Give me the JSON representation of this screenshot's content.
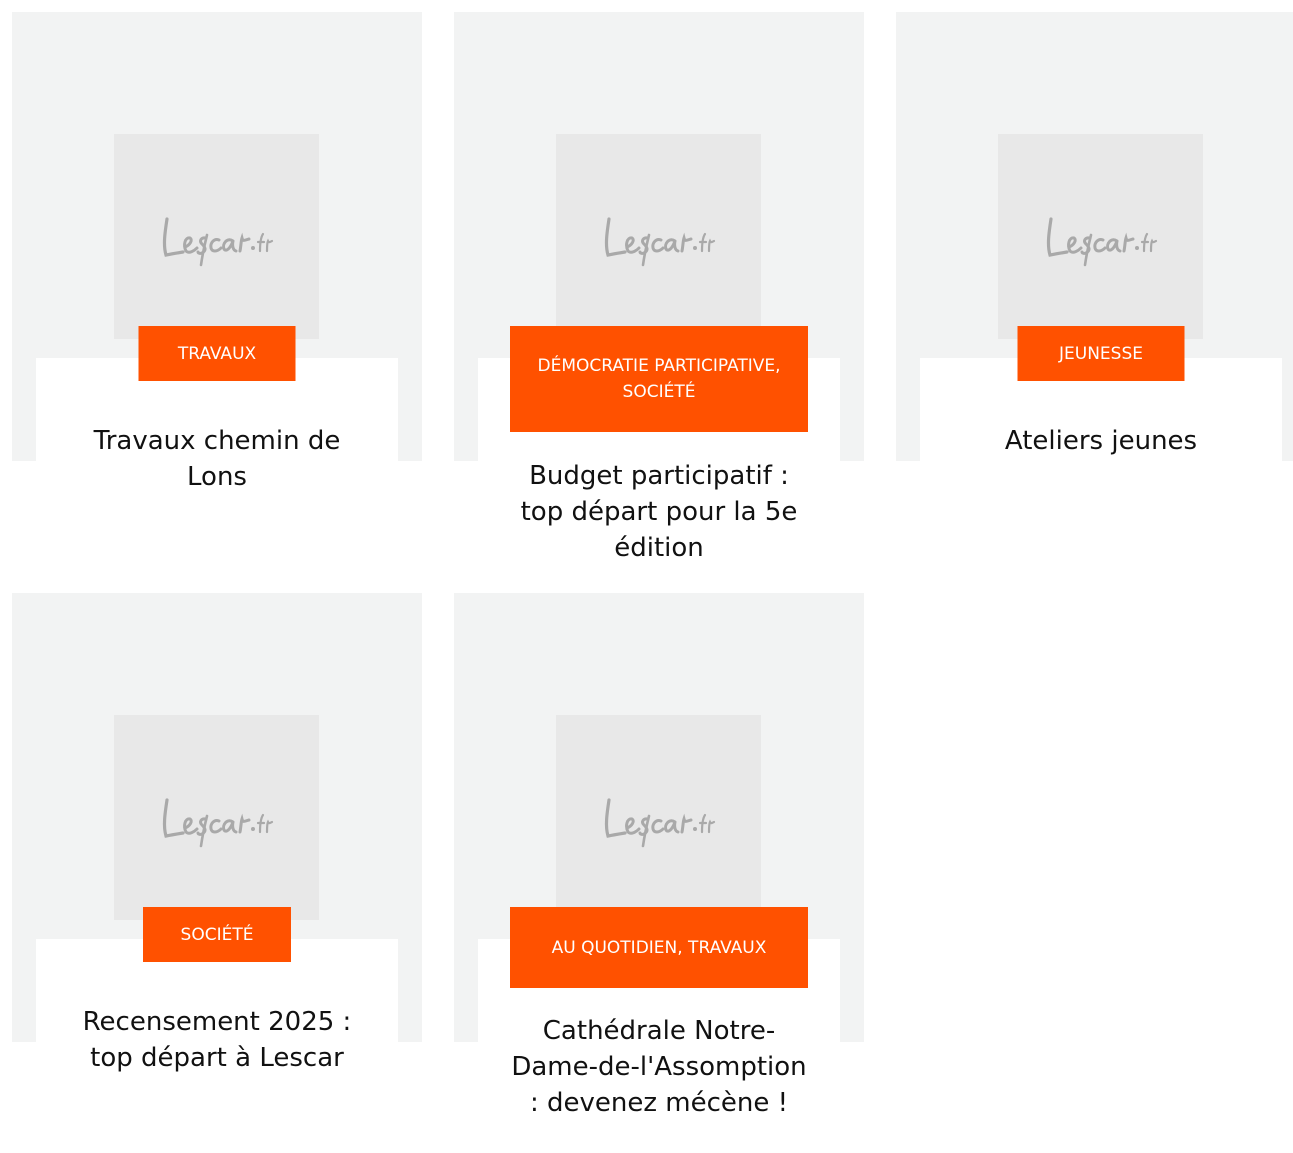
{
  "logo_text": "Lescar.fr",
  "colors": {
    "accent": "#ff5100",
    "card_bg": "#f2f3f3",
    "thumb_bg": "#e8e8e8",
    "logo": "#a9a9a9"
  },
  "articles": [
    {
      "category": "TRAVAUX",
      "title": "Travaux chemin de Lons"
    },
    {
      "category": "DÉMOCRATIE PARTICIPATIVE, SOCIÉTÉ",
      "title": "Budget participatif : top départ pour la 5e édition"
    },
    {
      "category": "JEUNESSE",
      "title": "Ateliers jeunes"
    },
    {
      "category": "SOCIÉTÉ",
      "title": "Recensement 2025 : top départ à Lescar"
    },
    {
      "category": "AU QUOTIDIEN, TRAVAUX",
      "title": "Cathédrale Notre-Dame-de-l'Assomption : devenez mécène !"
    }
  ]
}
